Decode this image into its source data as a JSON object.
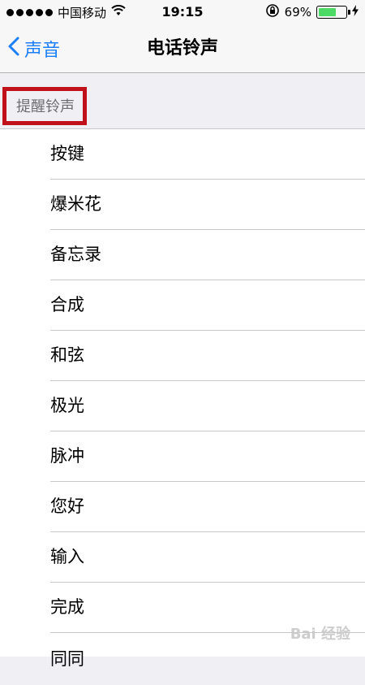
{
  "status_bar": {
    "carrier": "中国移动",
    "time": "19:15",
    "battery_percent": "69%",
    "battery_level": 0.69,
    "signal_icon": "signal-dots-icon",
    "wifi_icon": "wifi-icon",
    "rotation_lock_icon": "rotation-lock-icon",
    "charging_icon": "bolt-icon"
  },
  "nav": {
    "back_label": "声音",
    "title": "电话铃声"
  },
  "section": {
    "header": "提醒铃声"
  },
  "tones": [
    {
      "label": "按键"
    },
    {
      "label": "爆米花"
    },
    {
      "label": "备忘录"
    },
    {
      "label": "合成"
    },
    {
      "label": "和弦"
    },
    {
      "label": "极光"
    },
    {
      "label": "脉冲"
    },
    {
      "label": "您好"
    },
    {
      "label": "输入"
    },
    {
      "label": "完成"
    },
    {
      "label": "同同"
    }
  ],
  "watermark": "Bai 经验",
  "colors": {
    "accent": "#1b7ff7",
    "highlight_box": "#c0101a",
    "battery_fill": "#4cd964"
  }
}
